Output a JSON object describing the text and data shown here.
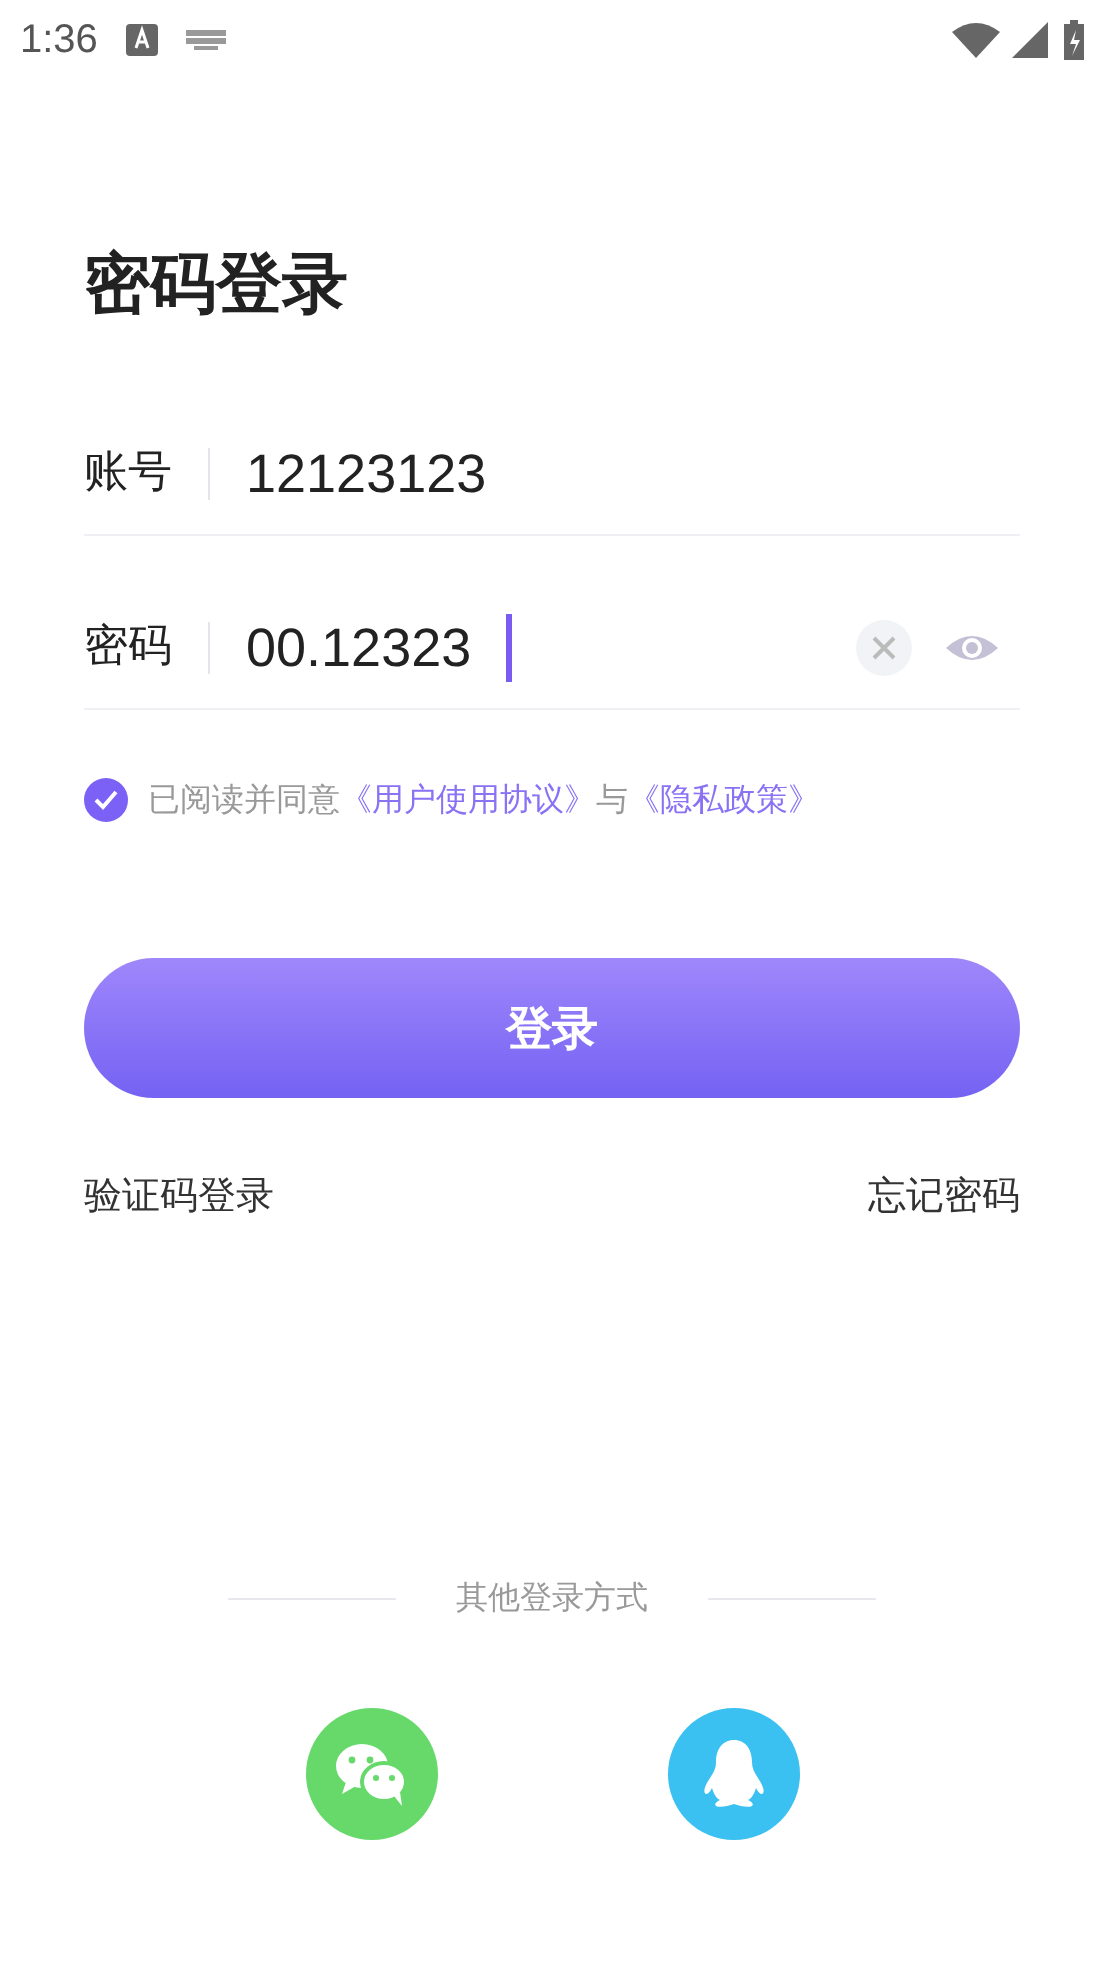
{
  "status_bar": {
    "time": "1:36"
  },
  "title": "密码登录",
  "fields": [
    {
      "label": "账号",
      "value": "12123123",
      "kind": "text"
    },
    {
      "label": "密码",
      "value": "00.12323",
      "kind": "password"
    }
  ],
  "agreement": {
    "checked": true,
    "prefix": "已阅读并同意",
    "link_1": "《用户使用协议》",
    "joiner": "与",
    "link_2": "《隐私政策》"
  },
  "login_button": "登录",
  "links": [
    "验证码登录",
    "忘记密码"
  ],
  "other_login": {
    "label": "其他登录方式",
    "options": [
      {
        "kind": "wechat",
        "color": "#66d96a"
      },
      {
        "kind": "qq",
        "color": "#3ac0f1"
      }
    ]
  }
}
